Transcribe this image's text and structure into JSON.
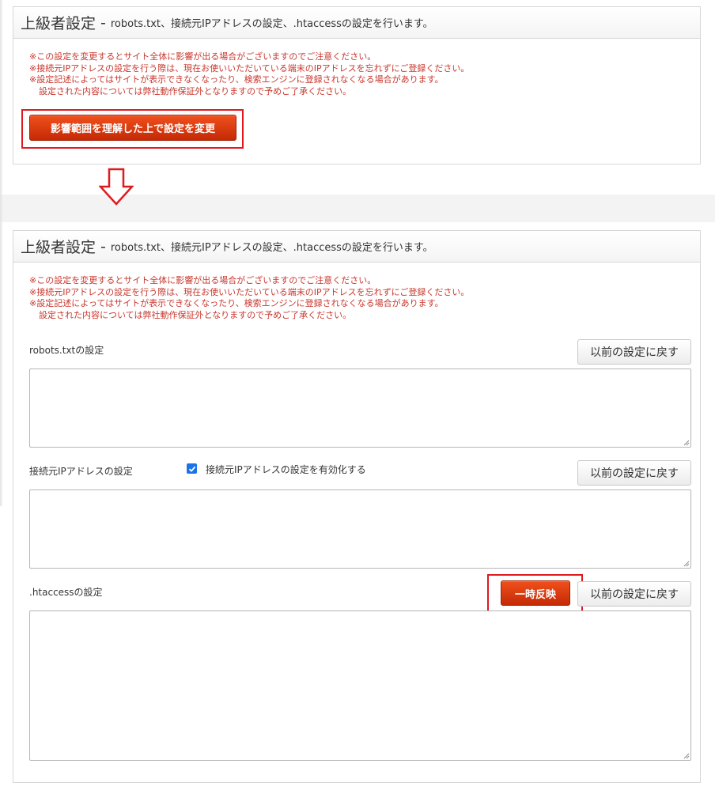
{
  "panel_title": "上級者設定",
  "panel_dash": "-",
  "panel_description": "robots.txt、接続元IPアドレスの設定、.htaccessの設定を行います。",
  "notes": [
    "※この設定を変更するとサイト全体に影響が出る場合がございますのでご注意ください。",
    "※接続元IPアドレスの設定を行う際は、現在お使いいただいている端末のIPアドレスを忘れずにご登録ください。",
    "※設定記述によってはサイトが表示できなくなったり、検索エンジンに登録されなくなる場合があります。",
    "設定された内容については弊社動作保証外となりますので予めご了承ください。"
  ],
  "change_settings_button": "影響範囲を理解した上で設定を変更",
  "robots": {
    "label": "robots.txtの設定",
    "revert_button": "以前の設定に戻す",
    "value": ""
  },
  "ip": {
    "label": "接続元IPアドレスの設定",
    "enable_label": "接続元IPアドレスの設定を有効化する",
    "enabled": true,
    "revert_button": "以前の設定に戻す",
    "value": ""
  },
  "htaccess": {
    "label": ".htaccessの設定",
    "apply_temp_button": "一時反映",
    "revert_button": "以前の設定に戻す",
    "value": ""
  },
  "colors": {
    "accent_red": "#e0191f",
    "button_red": "#d93a10",
    "note_red": "#c8372d",
    "checkbox_blue": "#1a73e8"
  },
  "icons": {
    "arrow": "arrow-down-outline-icon",
    "checkbox": "checkmark-icon",
    "resize": "resize-grip-icon"
  }
}
